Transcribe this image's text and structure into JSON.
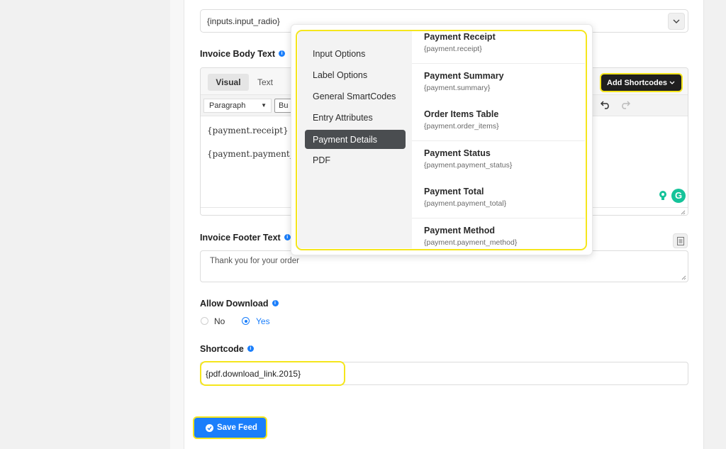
{
  "top_select": {
    "value": "{inputs.input_radio}"
  },
  "invoice_body": {
    "label": "Invoice Body Text",
    "tabs": [
      "Visual",
      "Text"
    ],
    "paragraph_select": "Paragraph",
    "partial_button": "Bu",
    "lines": [
      "{payment.receipt}",
      "{payment.payment_"
    ],
    "add_shortcodes": "Add Shortcodes"
  },
  "popup": {
    "sidebar": [
      "Input Options",
      "Label Options",
      "General SmartCodes",
      "Entry Attributes",
      "Payment Details",
      "PDF"
    ],
    "active": "Payment Details",
    "items": [
      {
        "title": "Payment Receipt",
        "code": "{payment.receipt}"
      },
      {
        "title": "Payment Summary",
        "code": "{payment.summary}"
      },
      {
        "title": "Order Items Table",
        "code": "{payment.order_items}"
      },
      {
        "title": "Payment Status",
        "code": "{payment.payment_status}"
      },
      {
        "title": "Payment Total",
        "code": "{payment.payment_total}"
      },
      {
        "title": "Payment Method",
        "code": "{payment.payment_method}"
      }
    ]
  },
  "invoice_footer": {
    "label": "Invoice Footer Text",
    "value": "Thank you for your order"
  },
  "allow_download": {
    "label": "Allow Download",
    "options": [
      "No",
      "Yes"
    ],
    "selected": "Yes"
  },
  "shortcode": {
    "label": "Shortcode",
    "value": "{pdf.download_link.2015}"
  },
  "save_button": "Save Feed",
  "colors": {
    "accent": "#1a7efb",
    "highlight": "#f5e61c",
    "dark": "#1f1f1f"
  }
}
